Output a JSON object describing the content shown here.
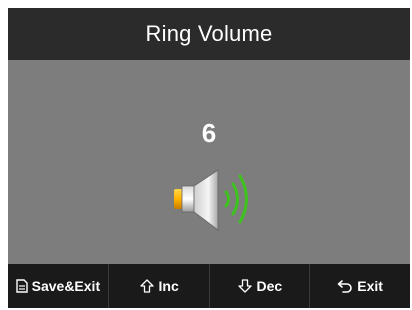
{
  "title": "Ring Volume",
  "volume": {
    "level": "6",
    "icon": "speaker-volume-icon",
    "wave_color": "#3ec21e"
  },
  "softkeys": [
    {
      "label": "Save&Exit",
      "icon": "save-icon"
    },
    {
      "label": "Inc",
      "icon": "arrow-up-icon"
    },
    {
      "label": "Dec",
      "icon": "arrow-down-icon"
    },
    {
      "label": "Exit",
      "icon": "back-arrow-icon"
    }
  ]
}
